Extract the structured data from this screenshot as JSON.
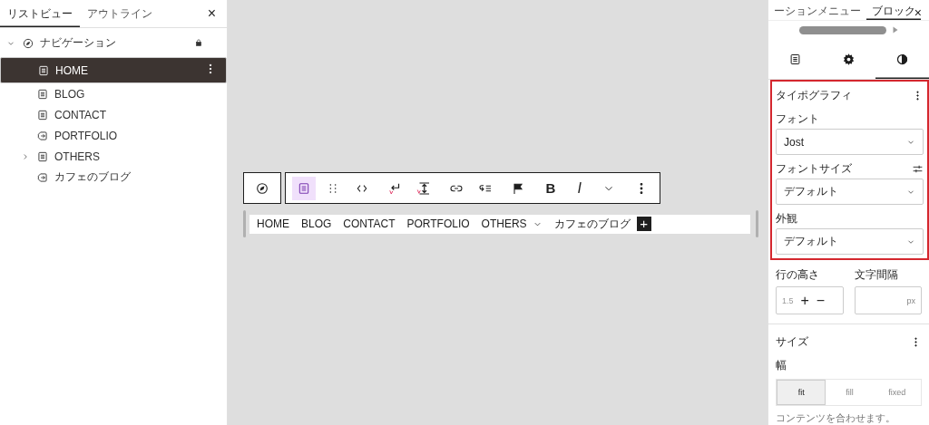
{
  "list_view": {
    "tabs": [
      {
        "label": "リストビュー",
        "selected": true
      },
      {
        "label": "アウトライン",
        "selected": false
      }
    ],
    "close": "×",
    "tree": [
      {
        "label": "ナビゲーション",
        "kind": "navigation",
        "expanded": true,
        "locked": true,
        "selected": false,
        "children": [
          {
            "label": "HOME",
            "kind": "page",
            "selected": true
          },
          {
            "label": "BLOG",
            "kind": "page",
            "selected": false
          },
          {
            "label": "CONTACT",
            "kind": "page",
            "selected": false
          },
          {
            "label": "PORTFOLIO",
            "kind": "link",
            "selected": false
          },
          {
            "label": "OTHERS",
            "kind": "page",
            "selected": false,
            "expanded": false
          },
          {
            "label": "カフェのブログ",
            "kind": "link",
            "selected": false
          }
        ]
      }
    ]
  },
  "canvas": {
    "toolbar": [
      [
        {
          "kind": "navigation",
          "selected": false
        }
      ],
      [
        {
          "kind": "page",
          "selected": true
        },
        {
          "kind": "drag",
          "selected": false
        },
        {
          "kind": "move",
          "selected": false
        }
      ],
      [
        {
          "kind": "enter",
          "selected": false
        },
        {
          "kind": "height",
          "selected": false
        }
      ],
      [
        {
          "kind": "link",
          "selected": false
        },
        {
          "kind": "submenu",
          "selected": false
        }
      ],
      [
        {
          "kind": "flag",
          "selected": false
        }
      ],
      [
        {
          "kind": "text",
          "label": "B",
          "selected": false
        },
        {
          "kind": "text",
          "label": "I",
          "selected": false
        },
        {
          "kind": "more",
          "selected": false
        }
      ],
      [
        {
          "kind": "options",
          "selected": false
        }
      ]
    ],
    "menu": [
      {
        "label": "HOME",
        "has_submenu": false
      },
      {
        "label": "BLOG",
        "has_submenu": false
      },
      {
        "label": "CONTACT",
        "has_submenu": false
      },
      {
        "label": "PORTFOLIO",
        "has_submenu": false
      },
      {
        "label": "OTHERS",
        "has_submenu": true
      },
      {
        "label": "カフェのブログ",
        "has_submenu": false
      }
    ],
    "add_button": "+"
  },
  "settings": {
    "tabs": [
      {
        "label": "ーションメニュー",
        "selected": false
      },
      {
        "label": "ブロック",
        "selected": true
      }
    ],
    "close": "×",
    "icon_tabs": [
      {
        "kind": "document",
        "selected": false
      },
      {
        "kind": "settings",
        "selected": false
      },
      {
        "kind": "styles",
        "selected": true
      }
    ],
    "typography": {
      "title": "タイポグラフィ",
      "highlighted": true,
      "fields": [
        {
          "label": "フォント",
          "value": "Jost",
          "kind": "select",
          "custom": false
        },
        {
          "label": "フォントサイズ",
          "value": "デフォルト",
          "kind": "select",
          "custom": true
        },
        {
          "label": "外観",
          "value": "デフォルト",
          "kind": "select",
          "custom": false
        }
      ],
      "line_height": {
        "label": "行の高さ",
        "placeholder": "1.5",
        "plus": "+",
        "minus": "−"
      },
      "letter_spacing": {
        "label": "文字間隔",
        "unit": "px"
      }
    },
    "size": {
      "title": "サイズ",
      "width_label": "幅",
      "options": [
        {
          "label": "fit",
          "selected": true
        },
        {
          "label": "fill",
          "selected": false
        },
        {
          "label": "fixed",
          "selected": false
        }
      ],
      "help": "コンテンツを合わせます。"
    }
  }
}
